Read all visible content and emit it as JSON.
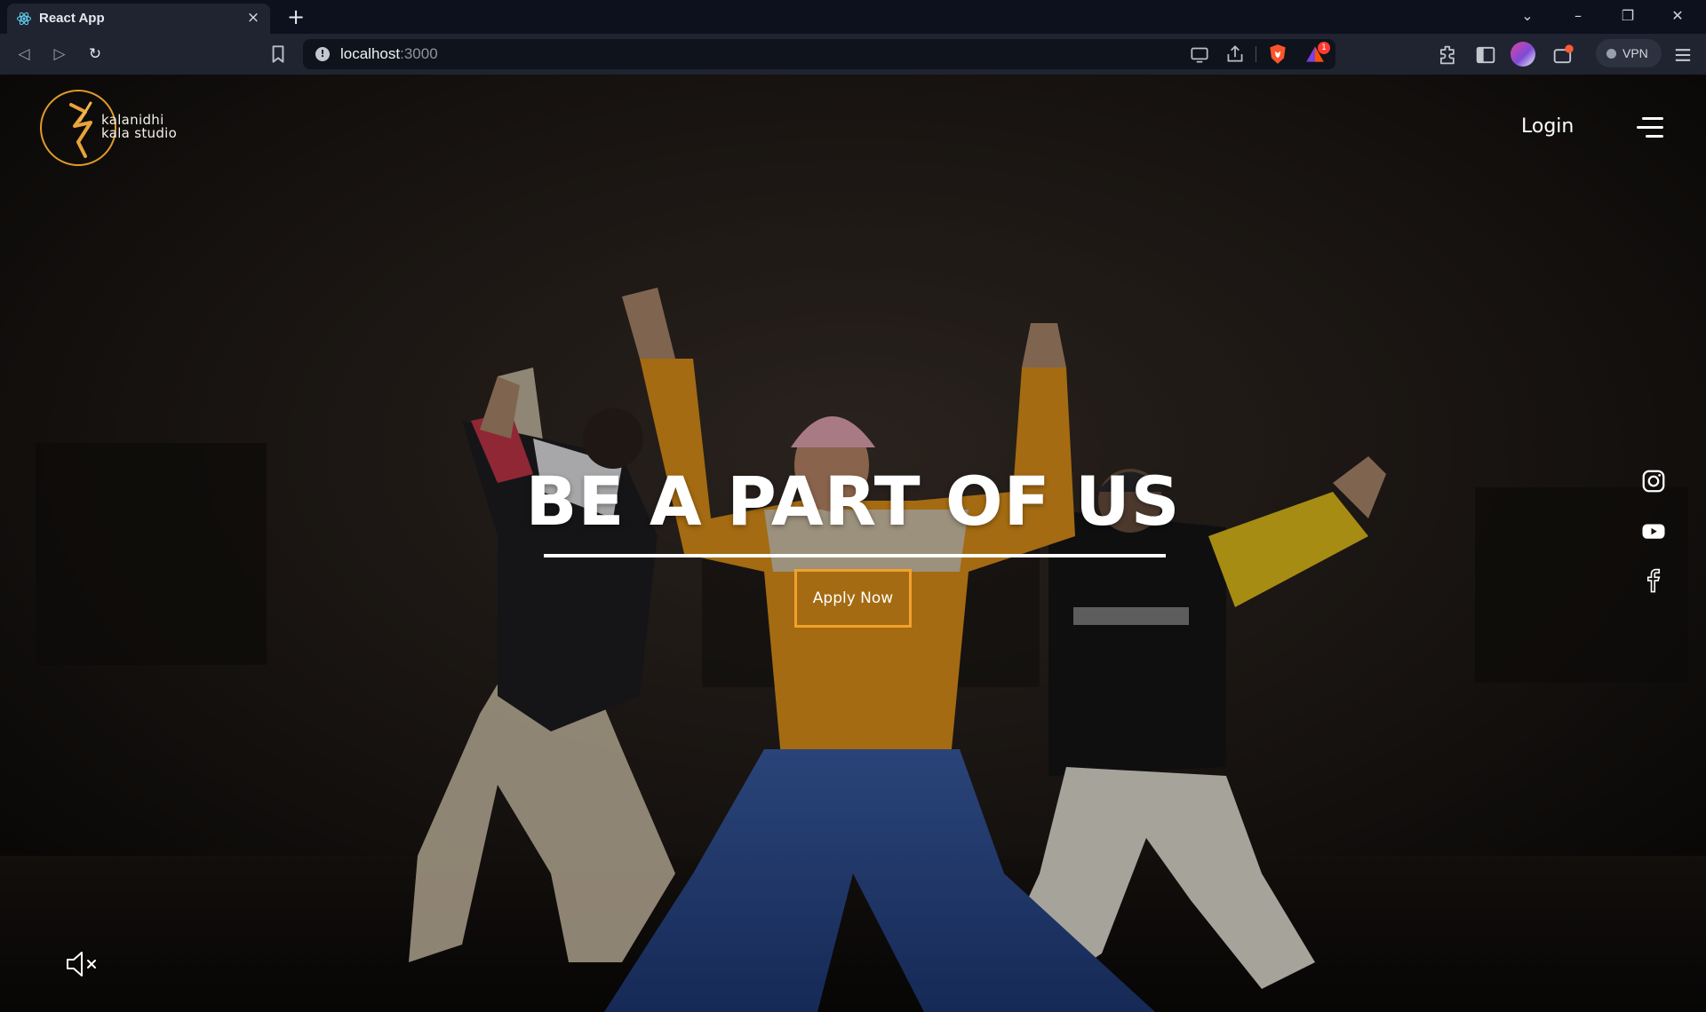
{
  "browser": {
    "tab": {
      "title": "React App",
      "favicon": "react-icon",
      "close_glyph": "×"
    },
    "new_tab_glyph": "+",
    "window_controls": {
      "dropdown": "⌄",
      "minimize": "–",
      "restore": "❐",
      "close": "✕"
    },
    "nav": {
      "back": "◁",
      "forward": "▷",
      "reload": "↻"
    },
    "url": {
      "host": "localhost",
      "port": ":3000"
    },
    "vpn_label": "VPN",
    "shield_badge": "1"
  },
  "site": {
    "logo_text_line1": "kalanidhi",
    "logo_text_line2": "kala studio",
    "login_label": "Login",
    "hero_title": "BE A PART OF US",
    "cta_label": "Apply Now",
    "social_icons": [
      "instagram-icon",
      "youtube-icon",
      "facebook-icon"
    ],
    "mute_icon": "speaker-muted-icon"
  },
  "colors": {
    "accent": "#f2a22a",
    "chrome_dark": "#0c111d",
    "chrome_toolbar": "#1f2430",
    "text_white": "#ffffff"
  }
}
